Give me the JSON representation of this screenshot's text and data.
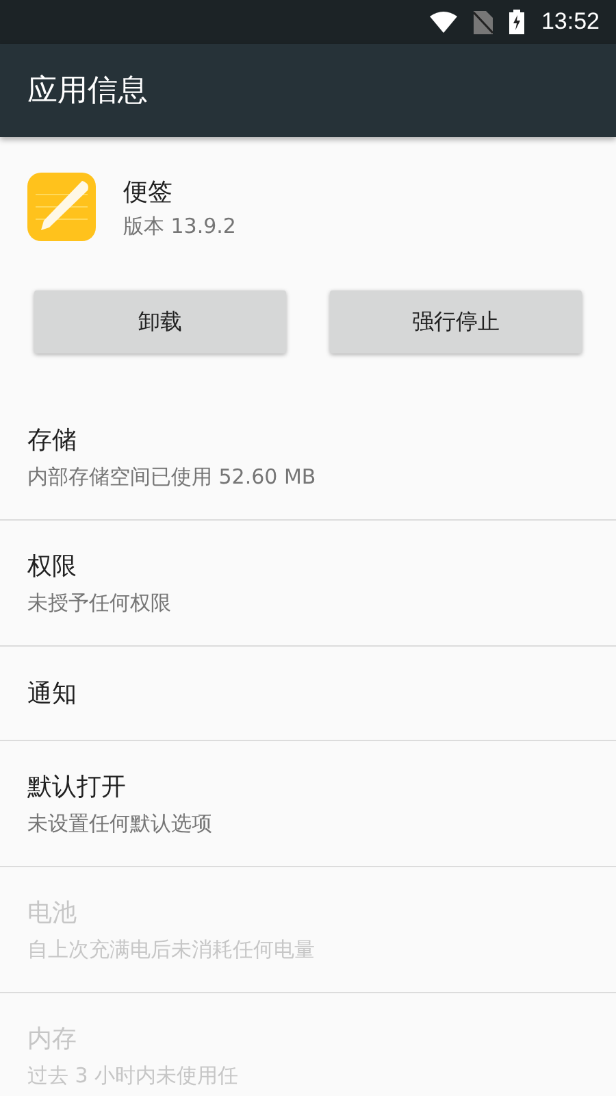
{
  "status_bar": {
    "time": "13:52"
  },
  "toolbar": {
    "title": "应用信息"
  },
  "app": {
    "name": "便签",
    "version": "版本 13.9.2"
  },
  "buttons": [
    {
      "label": "卸载"
    },
    {
      "label": "强行停止"
    }
  ],
  "items": [
    {
      "title": "存储",
      "summary": "内部存储空间已使用 52.60 MB",
      "disabled": false
    },
    {
      "title": "权限",
      "summary": "未授予任何权限",
      "disabled": false
    },
    {
      "title": "通知",
      "disabled": false
    },
    {
      "title": "默认打开",
      "summary": "未设置任何默认选项",
      "disabled": false
    },
    {
      "title": "电池",
      "summary": "自上次充满电后未消耗任何电量",
      "disabled": true
    },
    {
      "title": "内存",
      "summary": "过去 3 小时内未使用任",
      "disabled": true
    }
  ]
}
